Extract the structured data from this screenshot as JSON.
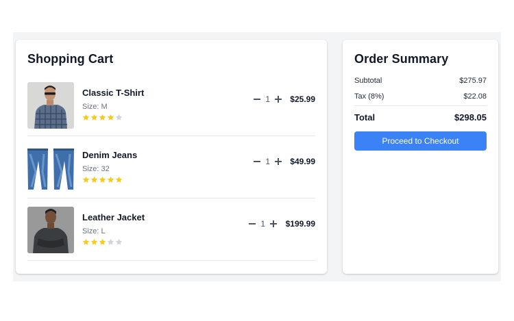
{
  "cart": {
    "title": "Shopping Cart",
    "items": [
      {
        "name": "Classic T-Shirt",
        "size": "Size: M",
        "rating": 4,
        "quantity": "1",
        "price": "$25.99",
        "image": "man-in-plaid-shirt-photo"
      },
      {
        "name": "Denim Jeans",
        "size": "Size: 32",
        "rating": 5,
        "quantity": "1",
        "price": "$49.99",
        "image": "blue-jeans-photo"
      },
      {
        "name": "Leather Jacket",
        "size": "Size: L",
        "rating": 3,
        "quantity": "1",
        "price": "$199.99",
        "image": "man-in-jacket-photo"
      }
    ],
    "icons": {
      "decrease": "minus-icon",
      "increase": "plus-icon",
      "rating": "star-icon"
    }
  },
  "summary": {
    "title": "Order Summary",
    "subtotal_label": "Subtotal",
    "subtotal_value": "$275.97",
    "tax_label": "Tax (8%)",
    "tax_value": "$22.08",
    "total_label": "Total",
    "total_value": "$298.05",
    "checkout_label": "Proceed to Checkout"
  },
  "colors": {
    "accent": "#3b82f6",
    "star_filled": "#facc15",
    "star_empty": "#d1d5db",
    "background": "#f3f4f6"
  }
}
